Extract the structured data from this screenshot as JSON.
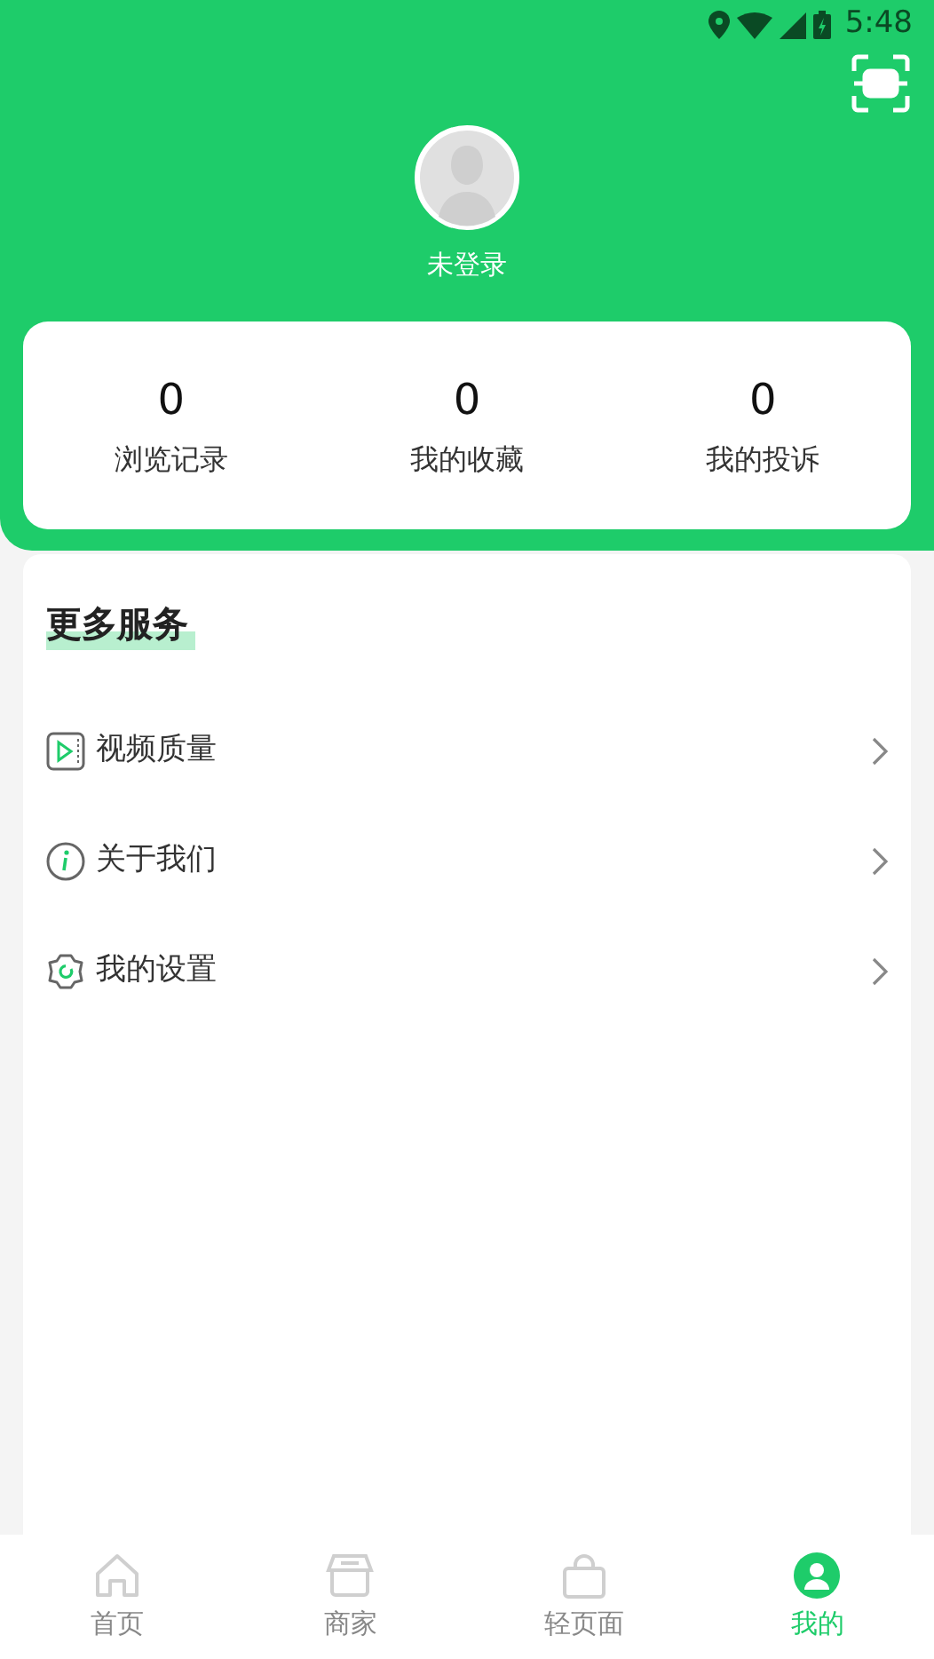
{
  "status_bar": {
    "time": "5:48"
  },
  "profile": {
    "name": "未登录"
  },
  "stats": [
    {
      "value": "0",
      "label": "浏览记录"
    },
    {
      "value": "0",
      "label": "我的收藏"
    },
    {
      "value": "0",
      "label": "我的投诉"
    }
  ],
  "services": {
    "title": "更多服务",
    "items": [
      {
        "kind": "video",
        "label": "视频质量"
      },
      {
        "kind": "info",
        "label": "关于我们"
      },
      {
        "kind": "settings",
        "label": "我的设置"
      }
    ]
  },
  "tab_bar": [
    {
      "kind": "home",
      "label": "首页",
      "selected": false
    },
    {
      "kind": "shop",
      "label": "商家",
      "selected": false
    },
    {
      "kind": "bag",
      "label": "轻页面",
      "selected": false
    },
    {
      "kind": "person",
      "label": "我的",
      "selected": true
    }
  ]
}
